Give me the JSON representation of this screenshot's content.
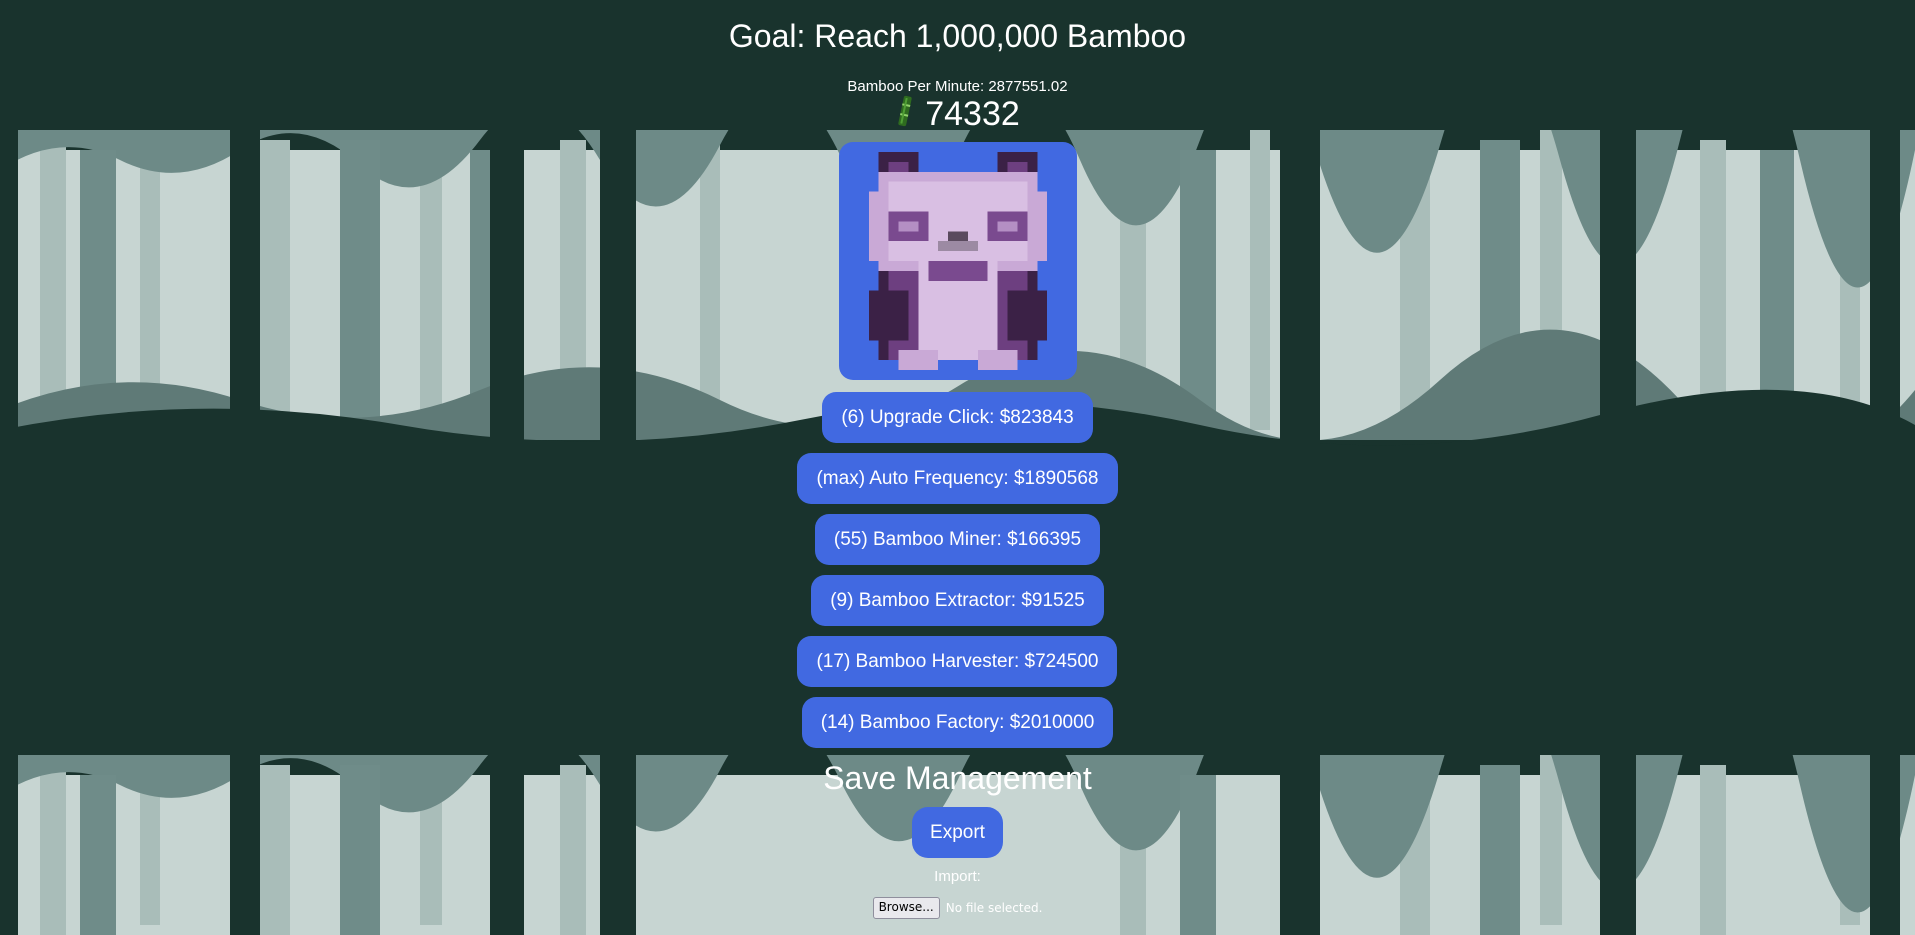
{
  "goal": "Goal: Reach 1,000,000 Bamboo",
  "bamboo_per_minute": "Bamboo Per Minute: 2877551.02",
  "bamboo_count": "74332",
  "upgrades": [
    {
      "label": "(6) Upgrade Click: $823843"
    },
    {
      "label": "(max) Auto Frequency: $1890568"
    },
    {
      "label": "(55) Bamboo Miner: $166395"
    },
    {
      "label": "(9) Bamboo Extractor: $91525"
    },
    {
      "label": "(17) Bamboo Harvester: $724500"
    },
    {
      "label": "(14) Bamboo Factory: $2010000"
    }
  ],
  "save": {
    "title": "Save Management",
    "export_label": "Export",
    "import_label": "Import:",
    "browse_label": "Browse...",
    "file_status": "No file selected."
  },
  "colors": {
    "background": "#19332d",
    "button": "#4169e1",
    "forest_light": "#cdd9d6",
    "forest_mid": "#9fb4b0",
    "forest_dark": "#5f7a77"
  },
  "icons": {
    "bamboo": "bamboo-icon",
    "panda": "panda-icon"
  }
}
